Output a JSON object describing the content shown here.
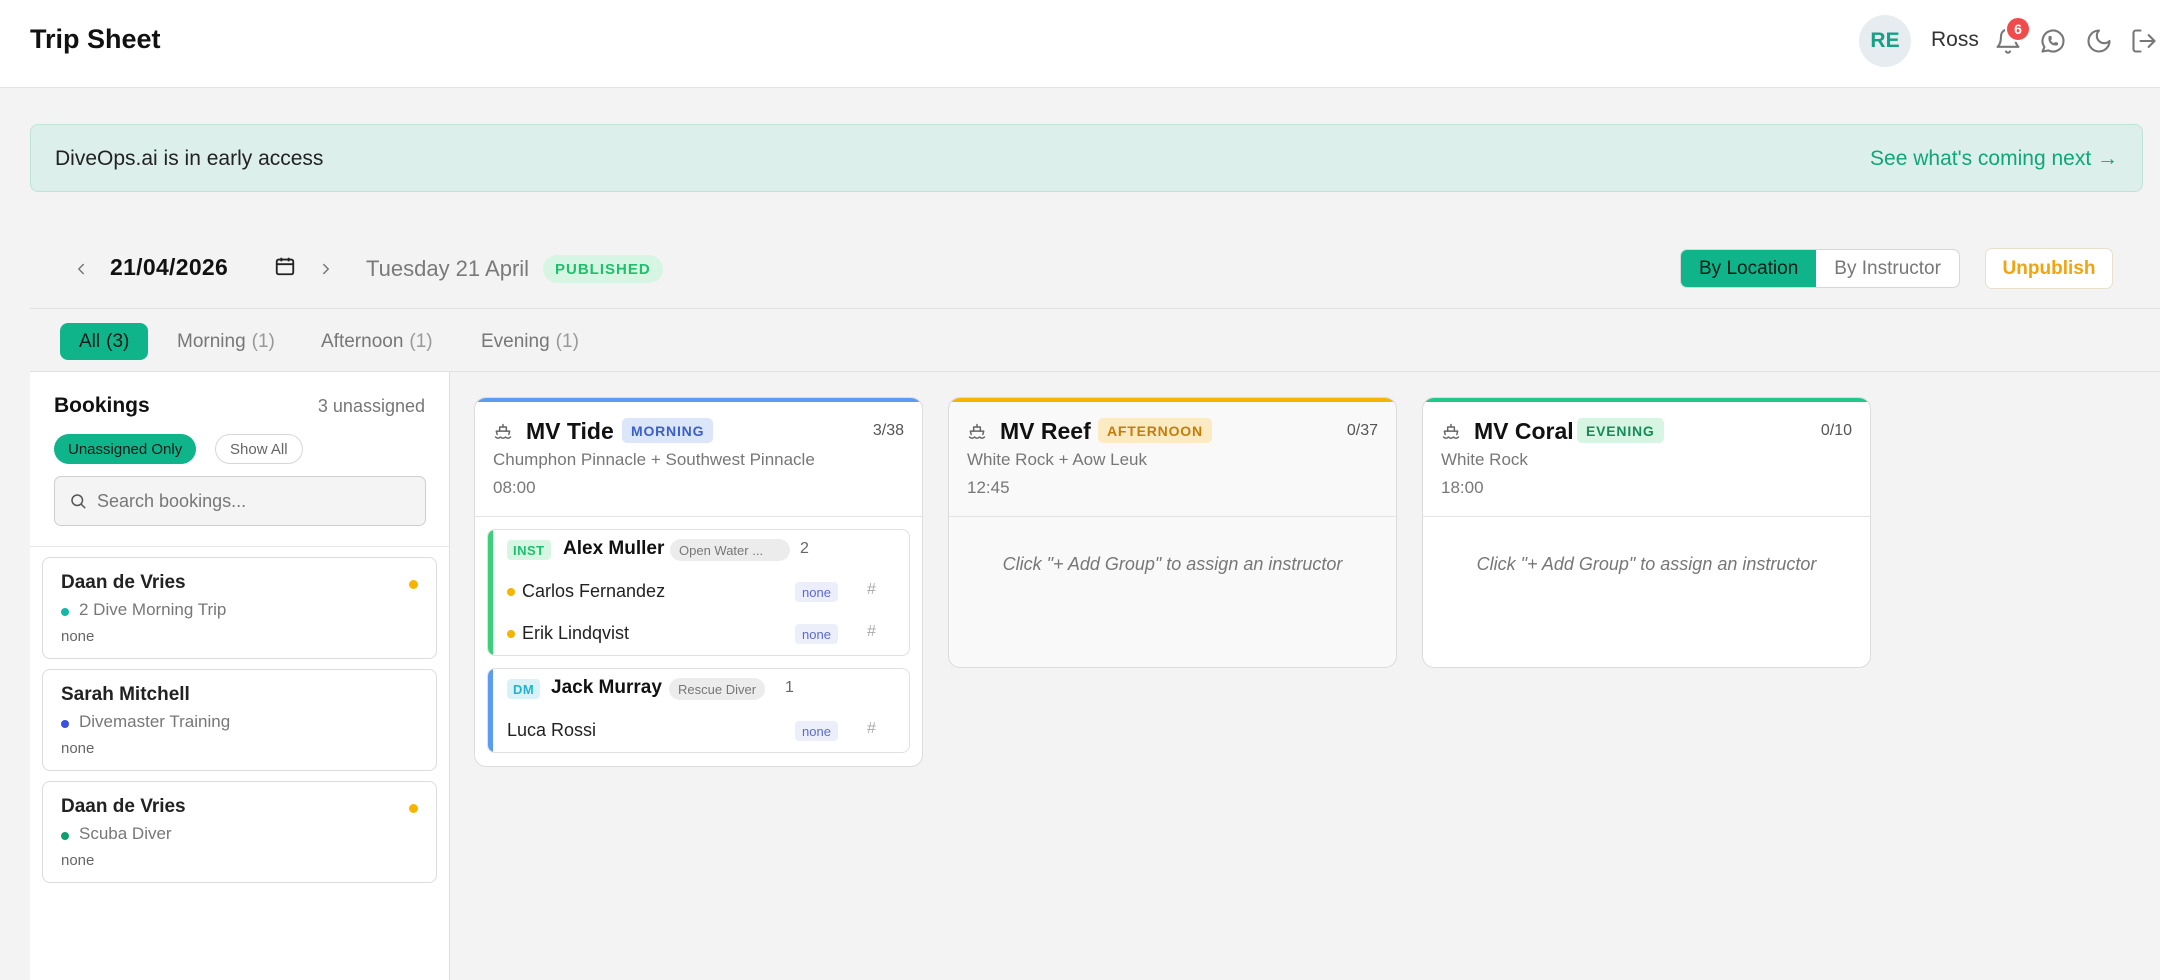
{
  "header": {
    "title": "Trip Sheet",
    "avatar_initials": "RE",
    "user_name": "Ross",
    "notification_count": "6"
  },
  "banner": {
    "text": "DiveOps.ai is in early access",
    "link": "See what's coming next →"
  },
  "datebar": {
    "date": "21/04/2026",
    "day_label": "Tuesday 21 April",
    "status": "PUBLISHED",
    "view_by_location": "By Location",
    "view_by_instructor": "By Instructor",
    "unpublish": "Unpublish"
  },
  "tabs": [
    {
      "label": "All",
      "count": "(3)"
    },
    {
      "label": "Morning",
      "count": "(1)"
    },
    {
      "label": "Afternoon",
      "count": "(1)"
    },
    {
      "label": "Evening",
      "count": "(1)"
    }
  ],
  "bookings": {
    "title": "Bookings",
    "unassigned": "3 unassigned",
    "filter_unassigned": "Unassigned Only",
    "filter_all": "Show All",
    "search_placeholder": "Search bookings...",
    "items": [
      {
        "name": "Daan de Vries",
        "course": "2 Dive Morning Trip",
        "course_color": "#14b8a6",
        "status": "none",
        "flag": true
      },
      {
        "name": "Sarah Mitchell",
        "course": "Divemaster Training",
        "course_color": "#3b4fe0",
        "status": "none",
        "flag": false
      },
      {
        "name": "Daan de Vries",
        "course": "Scuba Diver",
        "course_color": "#0f9f6e",
        "status": "none",
        "flag": true
      }
    ]
  },
  "trips": [
    {
      "name": "MV Tide",
      "session": "MORNING",
      "capacity": "3/38",
      "site": "Chumphon Pinnacle + Southwest Pinnacle",
      "time": "08:00",
      "accent": "#5b9cf2",
      "groups": [
        {
          "role": "INST",
          "instructor": "Alex Muller",
          "course": "Open Water ...",
          "count": "2",
          "accent": "#3dd07a",
          "divers": [
            {
              "name": "Carlos Fernandez",
              "tag": "none",
              "hash": "#",
              "dot": true
            },
            {
              "name": "Erik Lindqvist",
              "tag": "none",
              "hash": "#",
              "dot": true
            }
          ]
        },
        {
          "role": "DM",
          "instructor": "Jack Murray",
          "course": "Rescue Diver",
          "count": "1",
          "accent": "#5b9cf2",
          "divers": [
            {
              "name": "Luca Rossi",
              "tag": "none",
              "hash": "#",
              "dot": false
            }
          ]
        }
      ]
    },
    {
      "name": "MV Reef",
      "session": "AFTERNOON",
      "capacity": "0/37",
      "site": "White Rock + Aow Leuk",
      "time": "12:45",
      "accent": "#f4b400",
      "empty_text": "Click \"+ Add Group\" to assign an instructor"
    },
    {
      "name": "MV Coral",
      "session": "EVENING",
      "capacity": "0/10",
      "site": "White Rock",
      "time": "18:00",
      "accent": "#22c78a",
      "empty_text": "Click \"+ Add Group\" to assign an instructor"
    }
  ]
}
